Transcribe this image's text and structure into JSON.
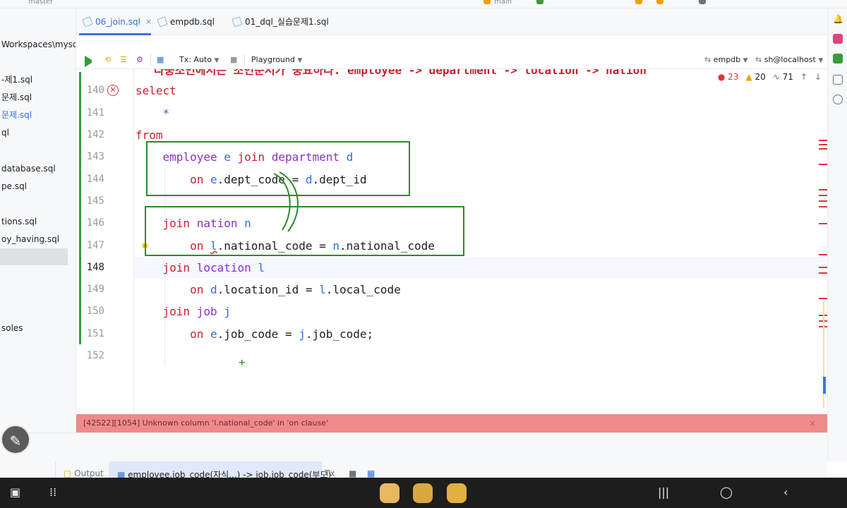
{
  "topbar": {
    "branch_left": "master",
    "branch_right": "main"
  },
  "project_panel": {
    "items": [
      {
        "label": "Workspaces\\mysql",
        "color": "normal"
      },
      {
        "label": "-제1.sql",
        "color": "normal"
      },
      {
        "label": "문제.sql",
        "color": "normal"
      },
      {
        "label": "문제.sql",
        "color": "blue"
      },
      {
        "label": "ql",
        "color": "normal"
      },
      {
        "label": "database.sql",
        "color": "normal"
      },
      {
        "label": "pe.sql",
        "color": "normal"
      },
      {
        "label": "tions.sql",
        "color": "normal"
      },
      {
        "label": "oy_having.sql",
        "color": "normal"
      },
      {
        "label": "soles",
        "color": "normal"
      }
    ]
  },
  "tabs": [
    {
      "label": "06_join.sql",
      "active": true,
      "close": "×"
    },
    {
      "label": "empdb.sql",
      "active": false
    },
    {
      "label": "01_dql_실습문제1.sql",
      "active": false
    }
  ],
  "toolbar": {
    "tx_label": "Tx: Auto",
    "playground_label": "Playground",
    "schema_label": "empdb",
    "datasource_label": "sh@localhost"
  },
  "inspections": {
    "errors": "23",
    "warnings": "20",
    "weak": "71",
    "up": "↑",
    "down": "↓"
  },
  "editor": {
    "top_cut_text": "다중조인에서는 조인순서가 중요하다. employee -> department -> location -> nation",
    "line_numbers": [
      "140",
      "141",
      "142",
      "143",
      "144",
      "145",
      "146",
      "147",
      "148",
      "149",
      "150",
      "151",
      "152"
    ],
    "lines": {
      "l140": {
        "kw": "select"
      },
      "l141": {
        "star": "*"
      },
      "l142": {
        "kw": "from"
      },
      "l143": {
        "t1": "employee",
        "a1": "e",
        "kw": "join",
        "t2": "department",
        "a2": "d"
      },
      "l144": {
        "kw": "on",
        "a1": "e",
        "c1": ".dept_code",
        "op": " = ",
        "a2": "d",
        "c2": ".dept_id"
      },
      "l146": {
        "kw": "join",
        "t": "nation",
        "a": "n"
      },
      "l147": {
        "kw": "on",
        "a1": "l",
        "c1": ".national_code",
        "op": " = ",
        "a2": "n",
        "c2": ".national_code"
      },
      "l148": {
        "kw": "join",
        "t": "location",
        "a": "l"
      },
      "l149": {
        "kw": "on",
        "a1": "d",
        "c1": ".location_id",
        "op": " = ",
        "a2": "l",
        "c2": ".local_code"
      },
      "l150": {
        "kw": "join",
        "t": "job",
        "a": "j"
      },
      "l151": {
        "kw": "on",
        "a1": "e",
        "c1": ".job_code",
        "op": " = ",
        "a2": "j",
        "c2": ".job_code;"
      }
    },
    "cursor_plus": "+"
  },
  "error_message": "[42S22][1054] Unknown column 'l.national_code' in 'on clause'",
  "error_close": "×",
  "bottom_tabs": {
    "output": "Output",
    "result": "employee.job_code(자식...) -> job.job_code(부모)",
    "tx": "Tx"
  },
  "colors": {
    "error_bar": "#f08a8a",
    "annotation": "#2b8a2b",
    "keyword": "#c8202d",
    "table": "#8a2fc4",
    "alias": "#2f6fd6"
  }
}
